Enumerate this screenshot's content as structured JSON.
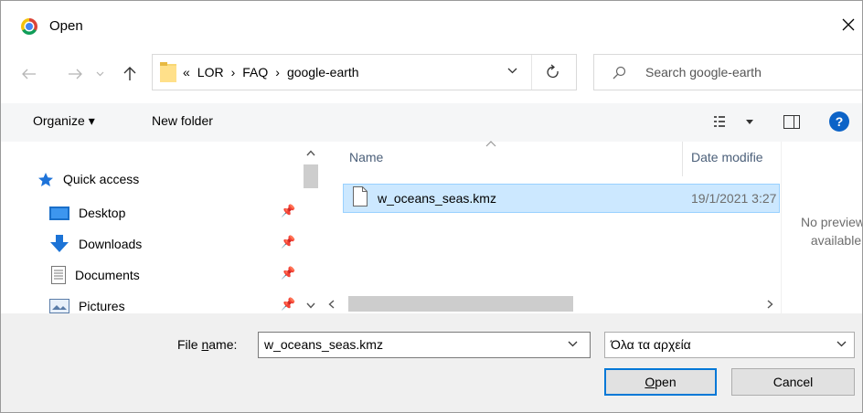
{
  "window": {
    "title": "Open",
    "close_glyph": "✕"
  },
  "nav": {
    "address": {
      "crumbs": [
        "«",
        "LOR",
        "›",
        "FAQ",
        "›",
        "google-earth"
      ]
    },
    "search": {
      "placeholder": "Search google-earth"
    }
  },
  "toolbar": {
    "organize_label": "Organize ▾",
    "new_folder_label": "New folder",
    "help_glyph": "?"
  },
  "sidebar": {
    "items": [
      {
        "label": "Quick access",
        "icon": "star-icon",
        "pinned": false
      },
      {
        "label": "Desktop",
        "icon": "desktop-icon",
        "pinned": true
      },
      {
        "label": "Downloads",
        "icon": "download-icon",
        "pinned": true
      },
      {
        "label": "Documents",
        "icon": "documents-icon",
        "pinned": true
      },
      {
        "label": "Pictures",
        "icon": "pictures-icon",
        "pinned": true
      }
    ]
  },
  "file_list": {
    "columns": [
      "Name",
      "Date modifie"
    ],
    "rows": [
      {
        "name": "w_oceans_seas.kmz",
        "date": "19/1/2021 3:27",
        "selected": true
      }
    ]
  },
  "preview": {
    "text": "No preview\navailable."
  },
  "bottom": {
    "file_name_label_pre": "File ",
    "file_name_label_u": "n",
    "file_name_label_post": "ame:",
    "file_name_value": "w_oceans_seas.kmz",
    "file_type": "Όλα τα αρχεία",
    "open_u": "O",
    "open_rest": "pen",
    "cancel_label": "Cancel"
  },
  "colors": {
    "selection": "#cce8ff",
    "accent": "#0078d7",
    "help": "#0c63c7"
  }
}
